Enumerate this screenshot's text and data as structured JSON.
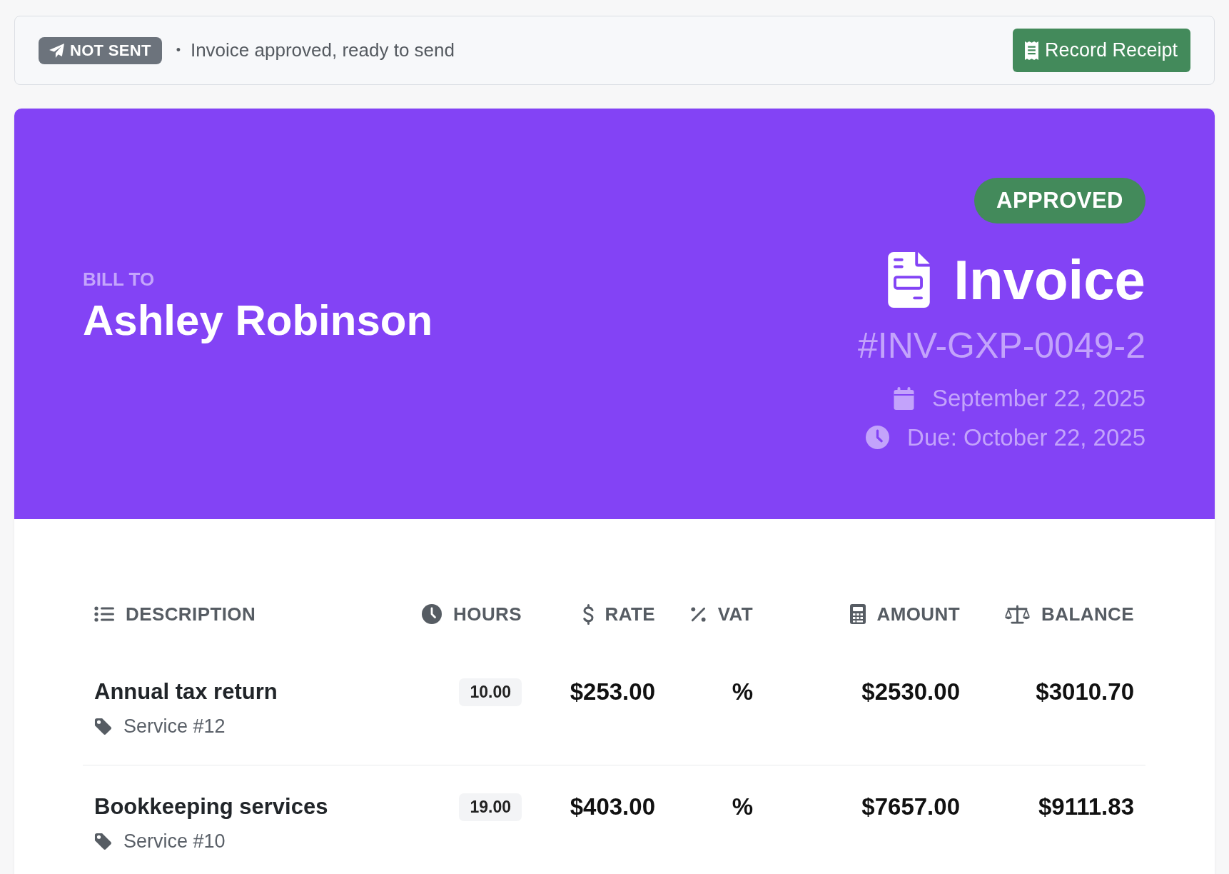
{
  "status_bar": {
    "badge": "NOT SENT",
    "separator": "•",
    "message": "Invoice approved, ready to send",
    "action_button": "Record Receipt"
  },
  "invoice_header": {
    "bill_to_label": "BILL TO",
    "client_name": "Ashley Robinson",
    "status": "APPROVED",
    "title": "Invoice",
    "number": "#INV-GXP-0049-2",
    "issue_date": "September 22, 2025",
    "due_date": "Due: October 22, 2025"
  },
  "line_items": {
    "columns": [
      "DESCRIPTION",
      "HOURS",
      "RATE",
      "VAT",
      "AMOUNT",
      "BALANCE"
    ],
    "rows": [
      {
        "description": "Annual tax return",
        "reference": "Service #12",
        "hours": "10.00",
        "rate": "$253.00",
        "vat": "%",
        "amount": "$2530.00",
        "balance": "$3010.70"
      },
      {
        "description": "Bookkeeping services",
        "reference": "Service #10",
        "hours": "19.00",
        "rate": "$403.00",
        "vat": "%",
        "amount": "$7657.00",
        "balance": "$9111.83"
      }
    ]
  }
}
